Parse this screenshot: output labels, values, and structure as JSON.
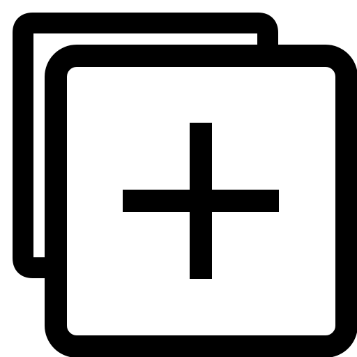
{
  "icon": {
    "name": "add-copy-icon",
    "description_label": "",
    "stroke_color": "#000000",
    "fill_color": "#ffffff"
  }
}
